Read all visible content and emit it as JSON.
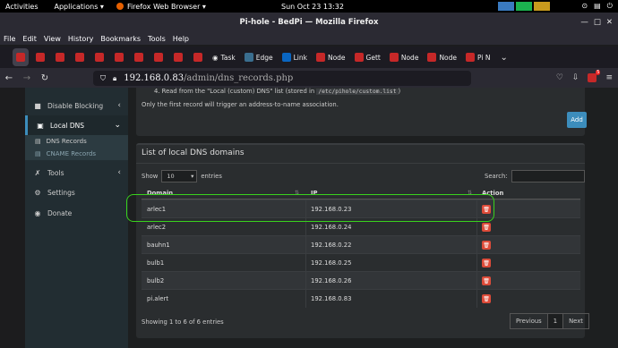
{
  "system": {
    "activities": "Activities",
    "applications": "Applications ▾",
    "app": "Firefox Web Browser ▾",
    "clock": "Sun Oct 23  13:32",
    "tray": [
      "⊙",
      "▤",
      "⏻"
    ]
  },
  "window": {
    "title": "Pi-hole - BedPi — Mozilla Firefox",
    "buttons": [
      "—",
      "□",
      "✕"
    ]
  },
  "menu": [
    "File",
    "Edit",
    "View",
    "History",
    "Bookmarks",
    "Tools",
    "Help"
  ],
  "tabs": [
    "Task",
    "Edge",
    "Link",
    "Node",
    "Gett",
    "Node",
    "Node",
    "Pi N"
  ],
  "url": {
    "host": "192.168.0.83",
    "path": "/admin/dns_records.php"
  },
  "extension_badge": "5",
  "sidebar": {
    "items": [
      {
        "label": "Disable Blocking",
        "icon": "stop-square-icon",
        "glyph": "■",
        "chev": "‹"
      },
      {
        "label": "Local DNS",
        "icon": "address-card-icon",
        "glyph": "▣",
        "chev": "⌄"
      },
      {
        "label": "Tools",
        "icon": "wrench-icon",
        "glyph": "✗",
        "chev": "‹"
      },
      {
        "label": "Settings",
        "icon": "gear-icon",
        "glyph": "⚙",
        "chev": ""
      },
      {
        "label": "Donate",
        "icon": "donate-icon",
        "glyph": "◉",
        "chev": ""
      }
    ],
    "sub": [
      {
        "label": "DNS Records",
        "glyph": "▤"
      },
      {
        "label": "CNAME Records",
        "glyph": "▤"
      }
    ]
  },
  "instructions": {
    "step4_prefix": "4. Read from the \"Local (custom) DNS\" list (stored in ",
    "step4_code": "/etc/pihole/custom.list",
    "step4_suffix": ")",
    "note": "Only the first record will trigger an address-to-name association."
  },
  "add_button": "Add",
  "list": {
    "title": "List of local DNS domains",
    "show": "Show",
    "entries_value": "10",
    "entries": "entries",
    "search_label": "Search:",
    "columns": [
      "Domain",
      "IP",
      "Action"
    ],
    "rows": [
      {
        "domain": "arlec1",
        "ip": "192.168.0.23"
      },
      {
        "domain": "arlec2",
        "ip": "192.168.0.24"
      },
      {
        "domain": "bauhn1",
        "ip": "192.168.0.22"
      },
      {
        "domain": "bulb1",
        "ip": "192.168.0.25"
      },
      {
        "domain": "bulb2",
        "ip": "192.168.0.26"
      },
      {
        "domain": "pi.alert",
        "ip": "192.168.0.83"
      }
    ],
    "info": "Showing 1 to 6 of 6 entries",
    "pager": {
      "prev": "Previous",
      "page": "1",
      "next": "Next"
    }
  },
  "highlight_color": "#39d21d"
}
